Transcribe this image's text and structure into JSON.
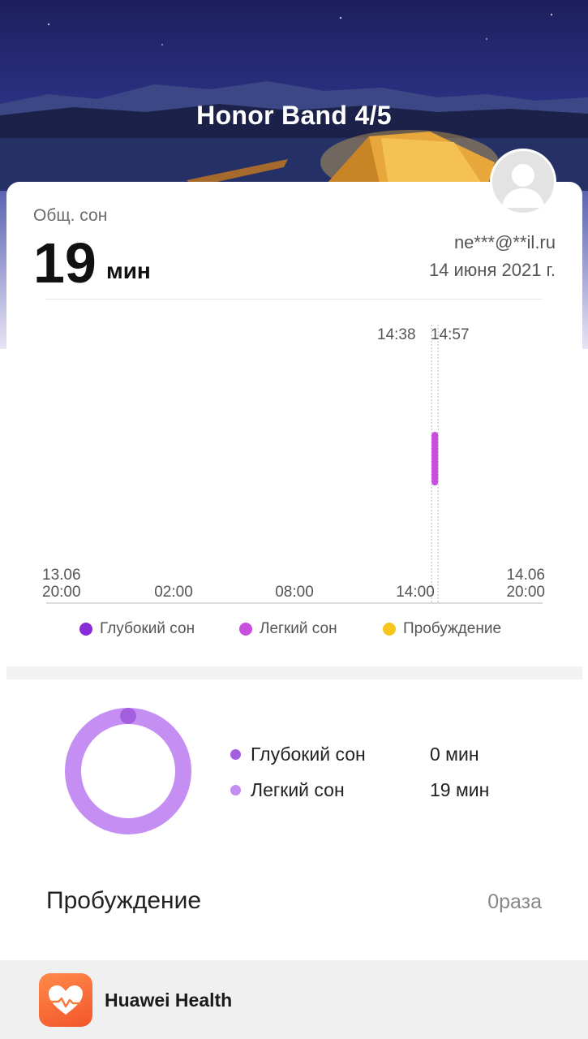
{
  "header": {
    "title": "Honor Band 4/5"
  },
  "summary": {
    "label": "Общ. сон",
    "value": "19",
    "unit": "мин",
    "email": "ne***@**il.ru",
    "date": "14 июня 2021 г."
  },
  "chart_data": {
    "type": "timeline",
    "x_ticks": [
      {
        "line1": "13.06",
        "line2": "20:00"
      },
      {
        "line1": "",
        "line2": "02:00"
      },
      {
        "line1": "",
        "line2": "08:00"
      },
      {
        "line1": "",
        "line2": "14:00"
      },
      {
        "line1": "14.06",
        "line2": "20:00"
      }
    ],
    "start_marker": "14:38",
    "end_marker": "14:57",
    "segments": [
      {
        "stage": "Легкий сон",
        "start": "14:38",
        "end": "14:57"
      }
    ],
    "legend": [
      {
        "label": "Глубокий сон",
        "color": "#8a2ad8"
      },
      {
        "label": "Легкий сон",
        "color": "#c94ddf"
      },
      {
        "label": "Пробуждение",
        "color": "#f7c51c"
      }
    ]
  },
  "breakdown": {
    "items": [
      {
        "label": "Глубокий сон",
        "value": "0 мин",
        "color": "#a45ee0"
      },
      {
        "label": "Легкий сон",
        "value": "19 мин",
        "color": "#c58ef2"
      }
    ],
    "deep_fraction": 0.0,
    "light_fraction": 1.0
  },
  "wake": {
    "label": "Пробуждение",
    "value": "0раза"
  },
  "footer": {
    "app_name": "Huawei Health"
  }
}
